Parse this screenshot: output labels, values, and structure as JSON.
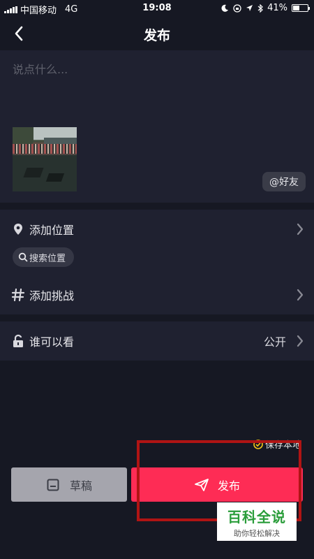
{
  "status_bar": {
    "carrier": "中国移动",
    "network": "4G",
    "time": "19:08",
    "battery": "41%"
  },
  "header": {
    "title": "发布",
    "back_icon": "chevron-left-icon"
  },
  "caption": {
    "placeholder": "说点什么...",
    "friend_label": "@好友"
  },
  "options": {
    "location_label": "添加位置",
    "search_location_label": "搜索位置",
    "challenge_label": "添加挑战",
    "privacy_label": "谁可以看",
    "privacy_value": "公开"
  },
  "save_local": {
    "label": "保存本地"
  },
  "buttons": {
    "draft_label": "草稿",
    "publish_label": "发布"
  },
  "watermark": {
    "main": "百科全说",
    "sub": "助你轻松解决"
  },
  "colors": {
    "background": "#161823",
    "card": "#1f2130",
    "publish": "#fe2c55",
    "draft": "#a5a5ad",
    "highlight": "#b01414",
    "watermark": "#2a9d3a"
  }
}
